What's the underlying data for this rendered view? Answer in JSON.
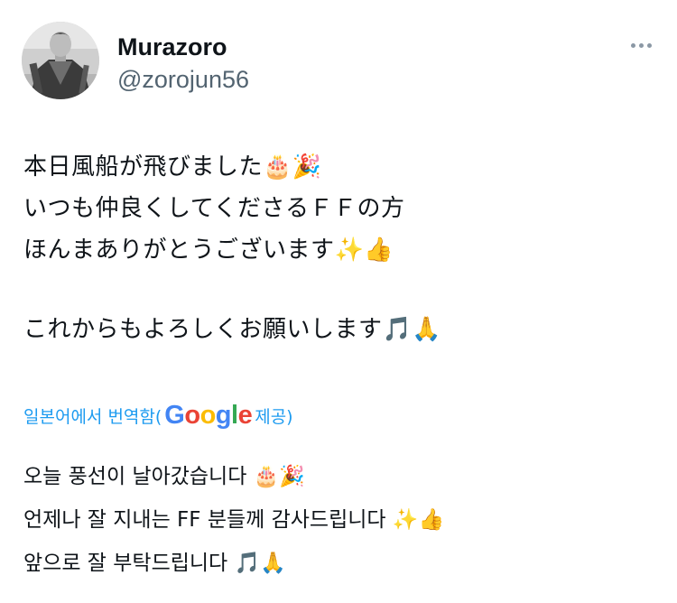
{
  "user": {
    "display_name": "Murazoro",
    "handle": "@zorojun56"
  },
  "tweet": {
    "lines": [
      "本日風船が飛びました🎂🎉",
      "いつも仲良くしてくださるＦＦの方",
      "ほんまありがとうございます✨👍",
      "",
      "これからもよろしくお願いします🎵🙏"
    ]
  },
  "translation": {
    "label_before": "일본어에서 번역함(",
    "google_letters": [
      "G",
      "o",
      "o",
      "g",
      "l",
      "e"
    ],
    "label_after": " 제공)",
    "lines": [
      "오늘 풍선이 날아갔습니다 🎂🎉",
      "언제나 잘 지내는 FF 분들께 감사드립니다 ✨👍",
      "앞으로 잘 부탁드립니다 🎵🙏"
    ]
  },
  "colors": {
    "text_primary": "#0f1419",
    "text_secondary": "#536471",
    "link": "#1d9bf0",
    "google_blue": "#4285f4",
    "google_red": "#ea4335",
    "google_yellow": "#fbbc05",
    "google_green": "#34a853"
  },
  "icons": {
    "more": "more-horizontal-icon",
    "avatar": "profile-avatar"
  }
}
